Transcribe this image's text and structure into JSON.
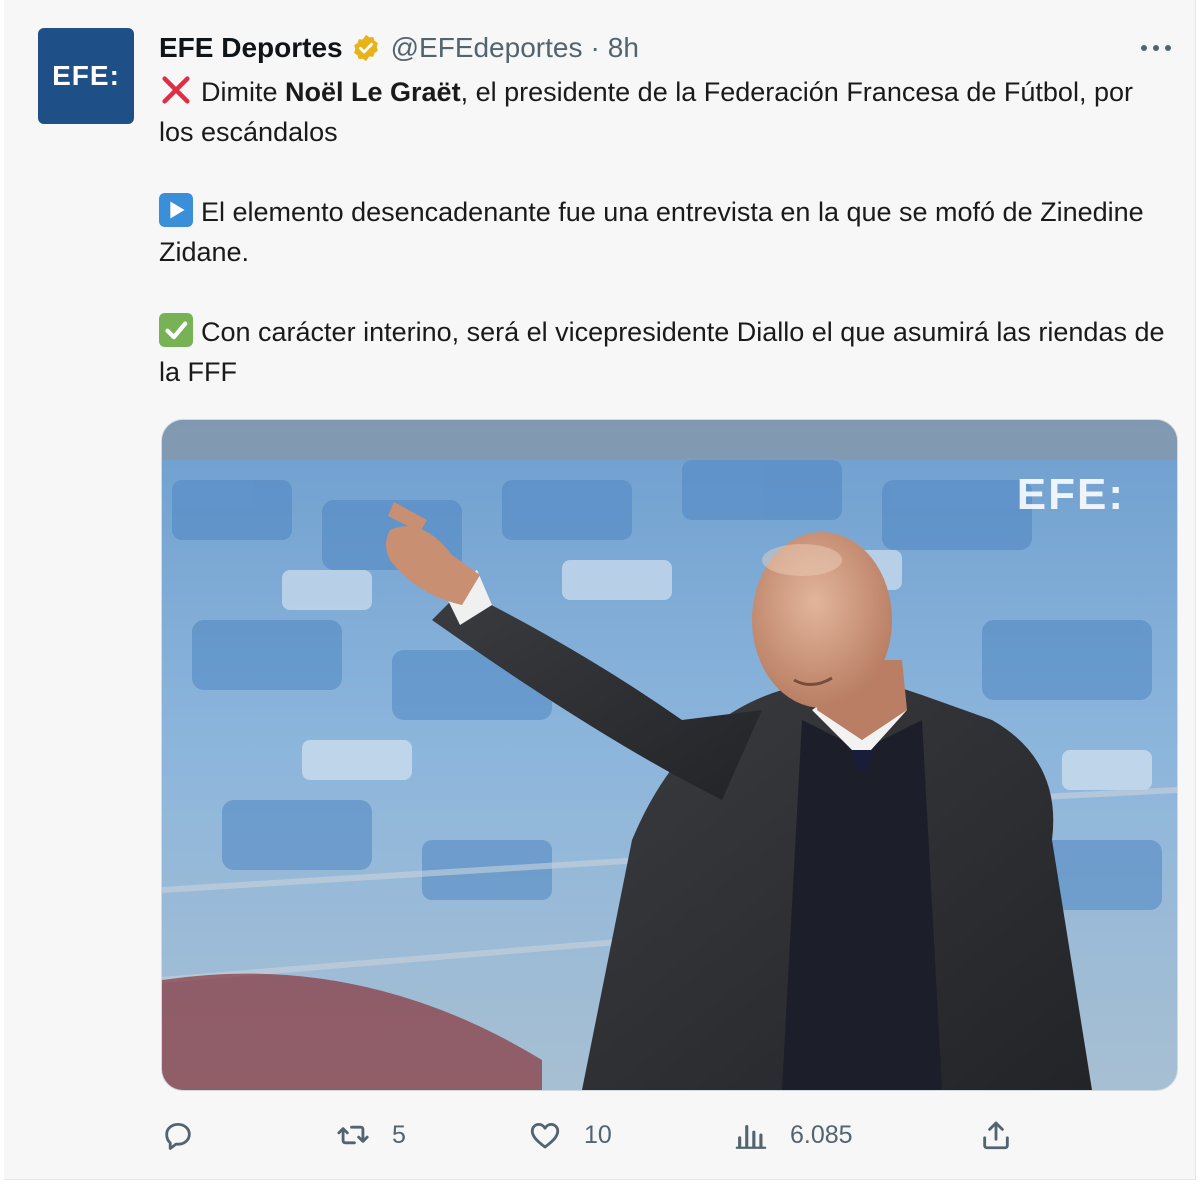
{
  "account": {
    "display_name": "EFE Deportes",
    "handle": "@EFEdeportes",
    "separator": "·",
    "time": "8h",
    "avatar_text": "EFE:"
  },
  "tweet": {
    "p1_pre": "Dimite ",
    "p1_bold": "Noël Le Graët",
    "p1_post": ", el presidente de la Federación Francesa de Fútbol, por los escándalos",
    "p2": "El elemento desencadenante fue una entrevista en la que se mofó de Zinedine Zidane.",
    "p3": "Con carácter interino, será el vicepresidente Diallo el que asumirá las riendas de la FFF"
  },
  "media": {
    "watermark": "EFE:"
  },
  "actions": {
    "retweets": "5",
    "likes": "10",
    "views": "6.085"
  },
  "colors": {
    "brand": "#1e4f87",
    "verified_badge": "#e8b21a",
    "secondary_text": "#536471"
  },
  "icons": [
    "more-icon",
    "verified-icon",
    "x-mark-emoji-icon",
    "play-emoji-icon",
    "check-emoji-icon",
    "reply-icon",
    "retweet-icon",
    "like-icon",
    "views-icon",
    "share-icon"
  ]
}
